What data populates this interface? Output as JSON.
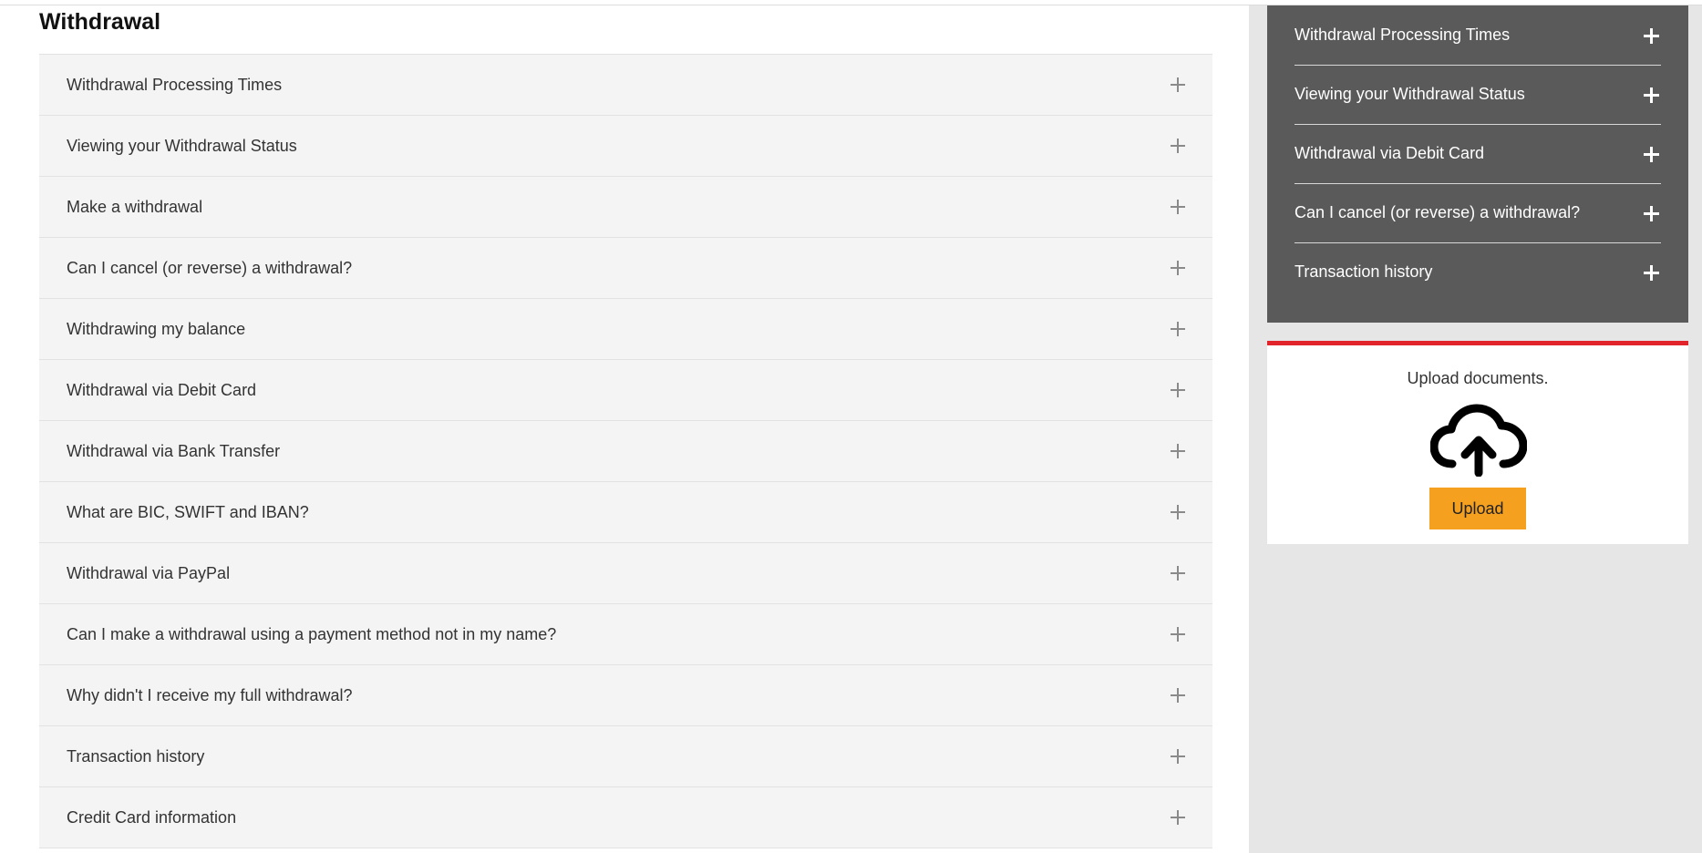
{
  "main": {
    "title": "Withdrawal",
    "faq_items": [
      {
        "label": "Withdrawal Processing Times"
      },
      {
        "label": "Viewing your Withdrawal Status"
      },
      {
        "label": "Make a withdrawal"
      },
      {
        "label": "Can I cancel (or reverse) a withdrawal?"
      },
      {
        "label": "Withdrawing my balance"
      },
      {
        "label": "Withdrawal via Debit Card"
      },
      {
        "label": "Withdrawal via Bank Transfer"
      },
      {
        "label": "What are BIC, SWIFT and IBAN?"
      },
      {
        "label": "Withdrawal via PayPal"
      },
      {
        "label": "Can I make a withdrawal using a payment method not in my name?"
      },
      {
        "label": "Why didn't I receive my full withdrawal?"
      },
      {
        "label": "Transaction history"
      },
      {
        "label": "Credit Card information"
      }
    ],
    "expand_icon": "plus-icon"
  },
  "sidebar": {
    "items": [
      {
        "label": "Withdrawal Processing Times"
      },
      {
        "label": "Viewing your Withdrawal Status"
      },
      {
        "label": "Withdrawal via Debit Card"
      },
      {
        "label": "Can I cancel (or reverse) a withdrawal?"
      },
      {
        "label": "Transaction history"
      }
    ],
    "panel_color": "#5a5a5a",
    "upload": {
      "text": "Upload documents.",
      "icon": "cloud-upload-icon",
      "button_label": "Upload",
      "accent_color": "#e0242a",
      "button_color": "#f6a020"
    }
  }
}
